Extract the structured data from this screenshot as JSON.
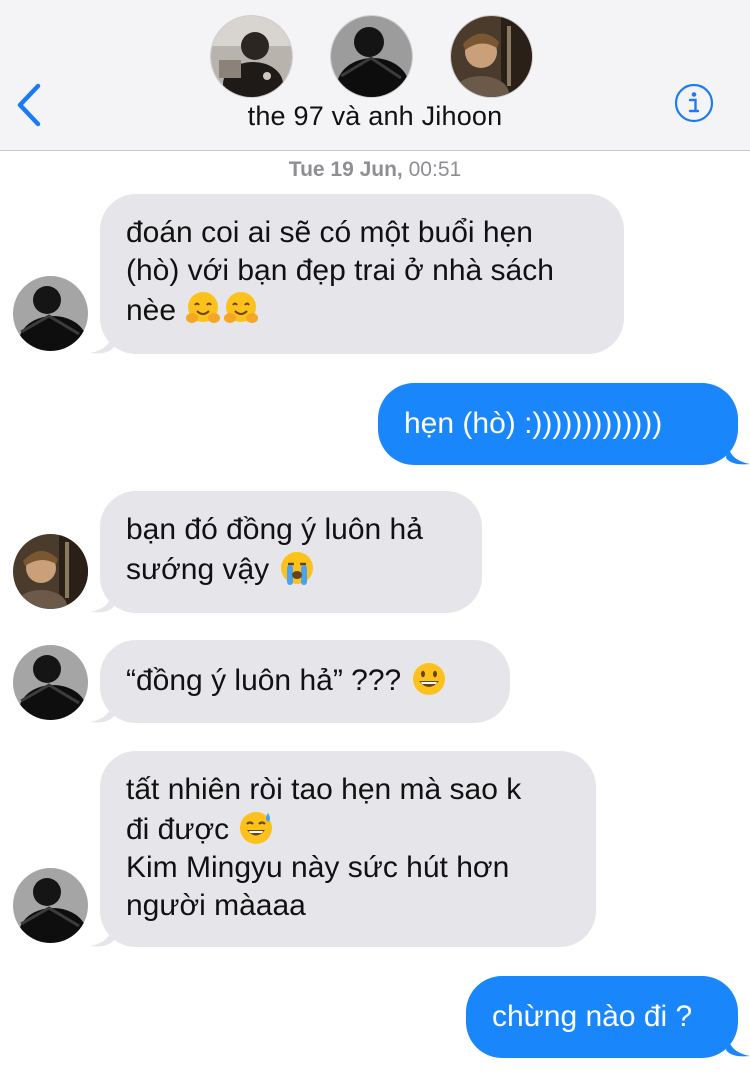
{
  "header": {
    "title": "the 97 và anh Jihoon",
    "participants": [
      "participant-1",
      "participant-2",
      "participant-3"
    ]
  },
  "timestamp": {
    "day": "Tue 19 Jun,",
    "time": "00:51"
  },
  "messages": [
    {
      "dir": "in",
      "avatar": "dark",
      "lines": [
        "đoán coi ai sẽ có một buổi hẹn",
        "(hò) với bạn đẹp trai ở nhà sách",
        "nèe"
      ],
      "emoji": "hugging-face-emoji hugging-face-emoji"
    },
    {
      "dir": "out",
      "lines": [
        "hẹn (hò) :)))))))))))))"
      ]
    },
    {
      "dir": "in",
      "avatar": "light",
      "lines": [
        "bạn đó đồng ý luôn hả",
        "sướng vậy"
      ],
      "emoji": "loudly-crying-emoji"
    },
    {
      "dir": "in",
      "avatar": "dark",
      "lines": [
        "“đồng ý luôn hả” ???"
      ],
      "emoji": "grinning-face-emoji"
    },
    {
      "dir": "in",
      "avatar": "dark",
      "lines": [
        "tất nhiên ròi tao hẹn mà sao k",
        "đi được",
        "Kim Mingyu này sức hút hơn",
        "người màaaa"
      ],
      "emoji": "sweat-smile-emoji"
    },
    {
      "dir": "out",
      "lines": [
        "chừng nào đi ?"
      ]
    }
  ],
  "colors": {
    "outgoing": "#1a86fb",
    "incoming": "#e5e5ea",
    "accent": "#1a7cf5"
  }
}
